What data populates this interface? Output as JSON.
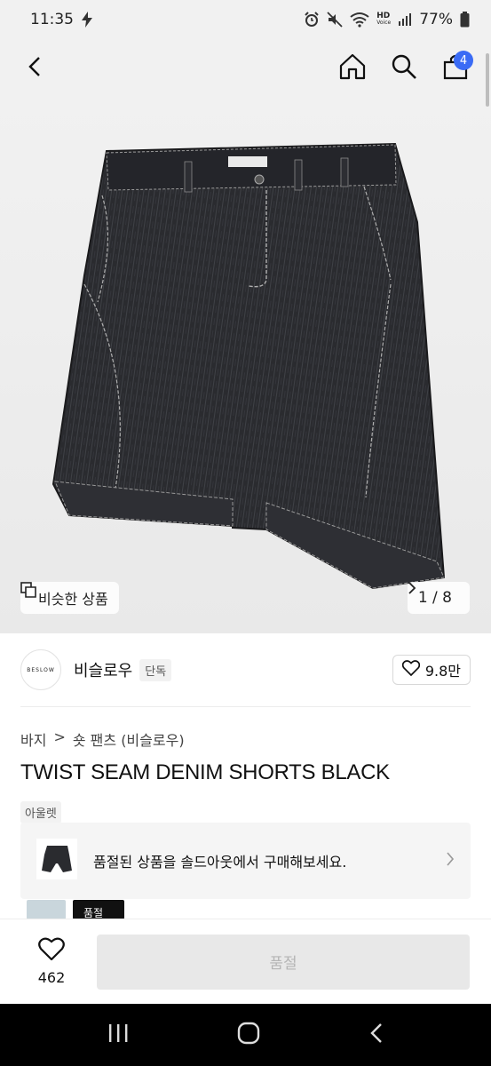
{
  "status_bar": {
    "time": "11:35",
    "network": "HD",
    "network_sub": "Voice",
    "battery": "77%"
  },
  "header": {
    "cart_count": "4"
  },
  "hero": {
    "similar_label": "비슷한 상품",
    "page_indicator": "1 / 8"
  },
  "brand": {
    "logo_text": "BESLOW",
    "name": "비슬로우",
    "tag": "단독",
    "likes": "9.8만"
  },
  "breadcrumb": [
    "바지",
    ">",
    "숏 팬츠 (비슬로우)"
  ],
  "product": {
    "title": "TWIST SEAM DENIM SHORTS BLACK",
    "outlet_tag": "아울렛"
  },
  "soldout_notice": {
    "text": "품절된 상품을 솔드아웃에서 구매해보세요."
  },
  "thumbnails": [
    {
      "label": ""
    },
    {
      "label": "품절"
    }
  ],
  "bottom_bar": {
    "wish_count": "462",
    "buy_label": "품절"
  },
  "colors": {
    "accent": "#3a6bf5",
    "disabled_bg": "#e8e8e8",
    "disabled_text": "#b5b5b5"
  },
  "icons": [
    "back-icon",
    "home-icon",
    "search-icon",
    "cart-icon",
    "copy-icon",
    "heart-icon",
    "chevron-right-icon"
  ]
}
